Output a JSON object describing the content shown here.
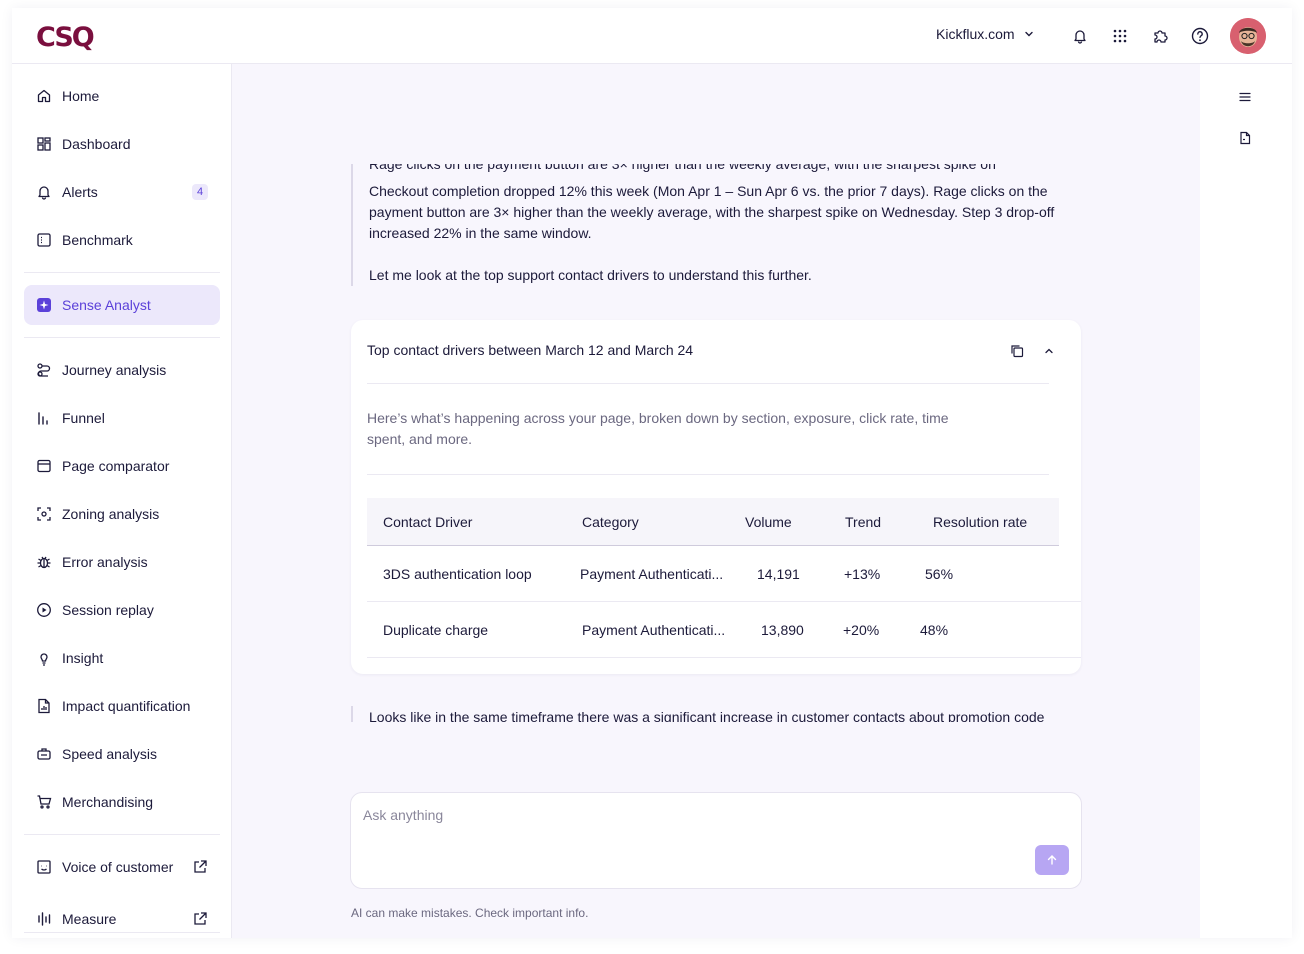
{
  "header": {
    "logo": "CSQ",
    "site": "Kickflux.com"
  },
  "sidebar": {
    "items": [
      {
        "label": "Home",
        "icon": "home-icon"
      },
      {
        "label": "Dashboard",
        "icon": "dashboard-icon"
      },
      {
        "label": "Alerts",
        "icon": "bell-icon",
        "badge": "4"
      },
      {
        "label": "Benchmark",
        "icon": "benchmark-icon"
      },
      {
        "label": "Sense Analyst",
        "icon": "sparkle-icon"
      },
      {
        "label": "Journey analysis",
        "icon": "journey-icon"
      },
      {
        "label": "Funnel",
        "icon": "funnel-icon"
      },
      {
        "label": "Page comparator",
        "icon": "page-comparator-icon"
      },
      {
        "label": "Zoning analysis",
        "icon": "zoning-icon"
      },
      {
        "label": "Error analysis",
        "icon": "bug-icon"
      },
      {
        "label": "Session replay",
        "icon": "play-icon"
      },
      {
        "label": "Insight",
        "icon": "lightbulb-icon"
      },
      {
        "label": "Impact quantification",
        "icon": "file-chart-icon"
      },
      {
        "label": "Speed analysis",
        "icon": "speed-icon"
      },
      {
        "label": "Merchandising",
        "icon": "cart-icon"
      },
      {
        "label": "Voice of customer",
        "icon": "voice-icon"
      },
      {
        "label": "Measure",
        "icon": "measure-icon"
      }
    ]
  },
  "chat": {
    "msg1_clipped": "Rage clicks on the payment button are 3× higher than the weekly average, with the sharpest spike on",
    "msg1_p1": "Checkout completion dropped 12% this week (Mon Apr 1 – Sun Apr 6 vs. the prior 7 days). Rage clicks on the payment button are 3× higher than the weekly average, with the sharpest spike on Wednesday. Step 3 drop-off increased 22% in the same window.",
    "msg1_p2": "Let me look at the top support contact drivers to understand this further.",
    "card": {
      "title": "Top contact drivers between March 12 and March 24",
      "description": "Here’s what’s happening across your page, broken down by section, exposure, click rate, time spent, and more.",
      "columns": [
        "Contact Driver",
        "Category",
        "Volume",
        "Trend",
        "Resolution rate"
      ],
      "rows": [
        [
          "3DS authentication loop",
          "Payment Authenticati...",
          "14,191",
          "+13%",
          "56%"
        ],
        [
          "Duplicate charge",
          "Payment Authenticati...",
          "13,890",
          "+20%",
          "48%"
        ]
      ]
    },
    "msg2": "Looks like in the same timeframe there was a significant increase in customer contacts about promotion code",
    "composer_placeholder": "Ask anything",
    "disclaimer": "AI can make mistakes. Check important info."
  },
  "colors": {
    "accent": "#5b41d9",
    "active_bg": "#ece8fb",
    "send_button": "#b7a6f3",
    "brand": "#7a0f3e"
  }
}
